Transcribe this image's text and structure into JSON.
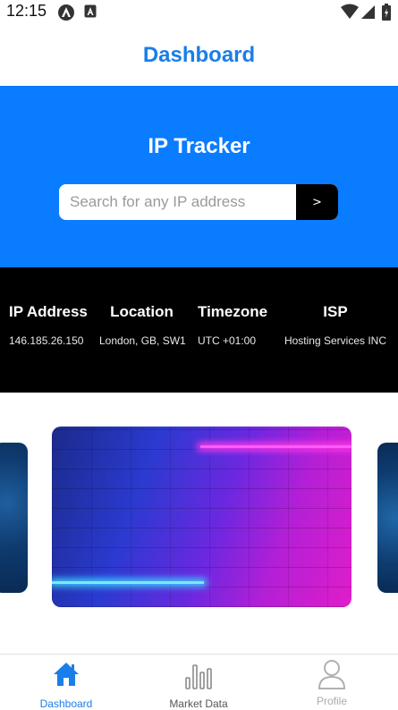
{
  "status_bar": {
    "time": "12:15"
  },
  "header": {
    "title": "Dashboard"
  },
  "banner": {
    "title": "IP Tracker",
    "search_placeholder": "Search for any IP address",
    "search_button": ">"
  },
  "info": {
    "columns": [
      {
        "label": "IP Address",
        "value": "146.185.26.150"
      },
      {
        "label": "Location",
        "value": "London, GB, SW1"
      },
      {
        "label": "Timezone",
        "value": "UTC +01:00"
      },
      {
        "label": "ISP",
        "value": "Hosting Services INC"
      }
    ]
  },
  "bottom_nav": {
    "items": [
      {
        "label": "Dashboard",
        "icon": "home-icon",
        "active": true
      },
      {
        "label": "Market Data",
        "icon": "bar-chart-icon",
        "active": false
      },
      {
        "label": "Profile",
        "icon": "person-icon",
        "active": false
      }
    ]
  },
  "colors": {
    "accent": "#1a7ee8",
    "banner": "#0a7cff",
    "info_bg": "#000000",
    "nav_active": "#1a7ee8",
    "nav_inactive": "#9a9a9a"
  }
}
